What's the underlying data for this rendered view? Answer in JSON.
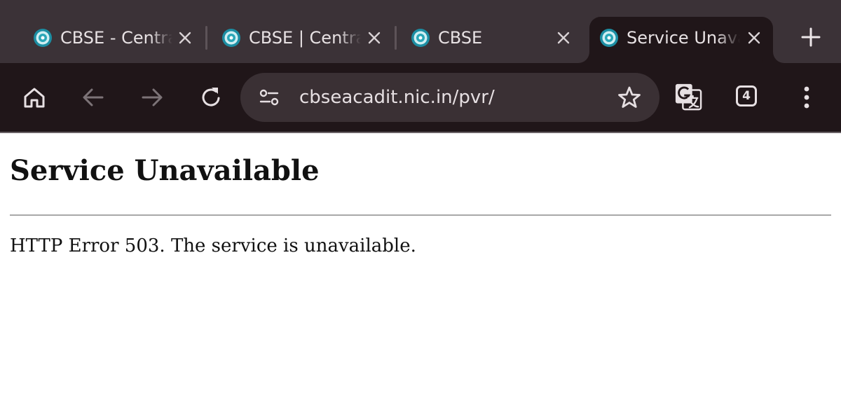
{
  "browser": {
    "tabs": [
      {
        "title": "CBSE - Central Board of Secondary Education",
        "active": false,
        "favicon": "cbse-logo-icon"
      },
      {
        "title": "CBSE | Central Board of Secondary Education",
        "active": false,
        "favicon": "cbse-logo-icon"
      },
      {
        "title": "CBSE",
        "active": false,
        "favicon": "cbse-logo-icon"
      },
      {
        "title": "Service Unavailable",
        "active": true,
        "favicon": "cbse-logo-icon"
      }
    ],
    "new_tab_icon": "plus-icon",
    "toolbar": {
      "home_icon": "home-icon",
      "back_icon": "arrow-left-icon",
      "forward_icon": "arrow-right-icon",
      "reload_icon": "reload-icon",
      "site_settings_icon": "tune-icon",
      "url": "cbseacadit.nic.in/pvr/",
      "bookmark_icon": "star-icon",
      "translate_icon": "translate-icon",
      "tab_count": "4",
      "menu_icon": "more-vert-icon"
    },
    "colors": {
      "tabstrip": "#3b3237",
      "toolbar": "#201619",
      "omnibox": "#3a3034"
    }
  },
  "page": {
    "heading": "Service Unavailable",
    "message": "HTTP Error 503. The service is unavailable."
  }
}
